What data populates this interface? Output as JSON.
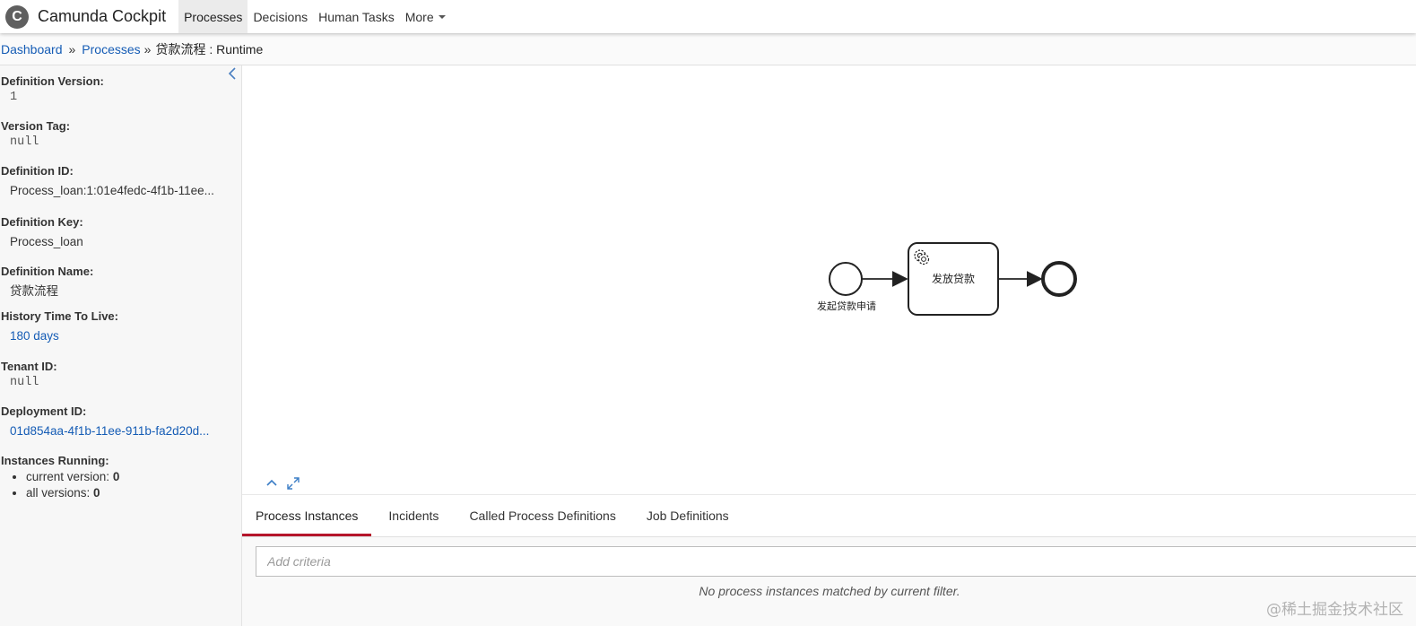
{
  "app": {
    "logo_letter": "C",
    "title": "Camunda Cockpit"
  },
  "nav": {
    "items": [
      {
        "label": "Processes",
        "active": true
      },
      {
        "label": "Decisions"
      },
      {
        "label": "Human Tasks"
      },
      {
        "label": "More"
      }
    ]
  },
  "breadcrumb": {
    "dashboard": "Dashboard",
    "separator": "»",
    "processes": "Processes",
    "current": "贷款流程 : Runtime"
  },
  "sidebar": {
    "collapse_icon": "chevron-left-icon",
    "definition_version": {
      "label": "Definition Version:",
      "value": "1"
    },
    "version_tag": {
      "label": "Version Tag:",
      "value": "null"
    },
    "definition_id": {
      "label": "Definition ID:",
      "value": "Process_loan:1:01e4fedc-4f1b-11ee..."
    },
    "definition_key": {
      "label": "Definition Key:",
      "value": "Process_loan"
    },
    "definition_name": {
      "label": "Definition Name:",
      "value": "贷款流程"
    },
    "history_ttl": {
      "label": "History Time To Live:",
      "value": "180 days"
    },
    "tenant_id": {
      "label": "Tenant ID:",
      "value": "null"
    },
    "deployment_id": {
      "label": "Deployment ID:",
      "value": "01d854aa-4f1b-11ee-911b-fa2d20d..."
    },
    "instances_running": {
      "label": "Instances Running:",
      "current_label": "current version:",
      "current_value": "0",
      "all_label": "all versions:",
      "all_value": "0"
    }
  },
  "diagram": {
    "start_event_label": "发起贷款申请",
    "service_task_label": "发放贷款",
    "service_task_icon": "gear-icon",
    "controls": {
      "collapse_icon": "chevron-up-icon",
      "fullscreen_icon": "expand-icon"
    }
  },
  "tabs": [
    {
      "label": "Process Instances",
      "active": true
    },
    {
      "label": "Incidents"
    },
    {
      "label": "Called Process Definitions"
    },
    {
      "label": "Job Definitions"
    }
  ],
  "filter": {
    "placeholder": "Add criteria",
    "empty_message": "No process instances matched by current filter."
  },
  "watermark": "@稀土掘金技术社区",
  "colors": {
    "link": "#155cb5",
    "active_tab_underline": "#b5152b",
    "logo_bg": "#5f5f5f"
  }
}
